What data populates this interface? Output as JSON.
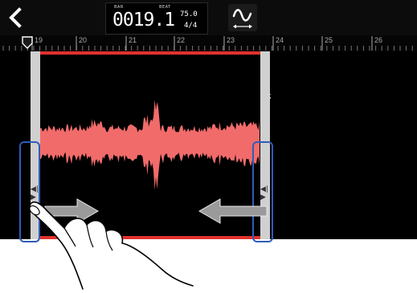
{
  "counter": {
    "label_bar": "BAR",
    "label_beat": "BEAT",
    "position": "0019.1",
    "tempo": "75.0",
    "time_signature": "4/4"
  },
  "ruler": {
    "bars": [
      "19",
      "20",
      "21",
      "22",
      "23",
      "24",
      "25",
      "26"
    ]
  },
  "icons": {
    "back": "chevron-left-icon",
    "wave_mode": "sine-wave-icon",
    "loop": "loop-icon",
    "playhead": "playhead-marker-icon"
  },
  "colors": {
    "waveform": "#f26b6b",
    "region_edge": "#e0322e",
    "handle": "#d0d0d0",
    "focus_outline": "#2f5cba"
  }
}
